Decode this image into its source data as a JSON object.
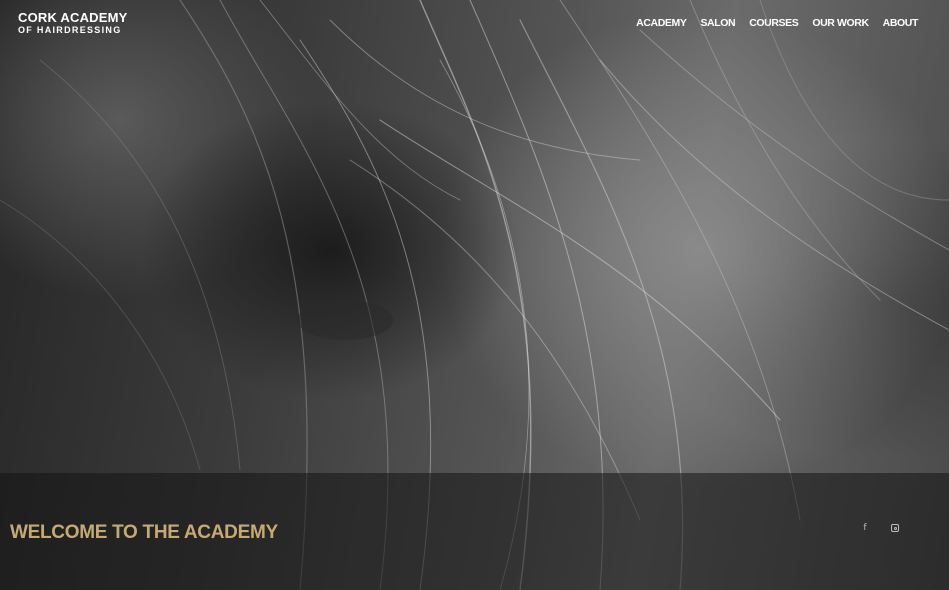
{
  "header": {
    "logo_line1": "CORK ACADEMY",
    "logo_line2": "OF HAIRDRESSING",
    "nav": [
      {
        "label": "ACADEMY"
      },
      {
        "label": "SALON"
      },
      {
        "label": "COURSES"
      },
      {
        "label": "OUR WORK"
      },
      {
        "label": "ABOUT"
      }
    ]
  },
  "hero": {
    "image": "black-and-white photo of woman with windswept hair",
    "heading": "WELCOME TO THE ACADEMY"
  },
  "social": {
    "facebook_glyph": "f",
    "icons": [
      "facebook-icon",
      "instagram-icon"
    ]
  },
  "colors": {
    "heading": "#c6aa73",
    "nav_text": "#ffffff",
    "band": "#141414"
  }
}
